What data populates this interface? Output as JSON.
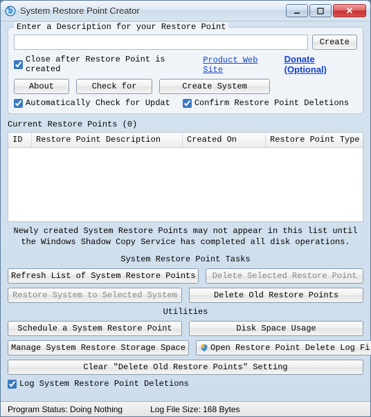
{
  "window": {
    "title": "System Restore Point Creator"
  },
  "descGroup": {
    "label": "Enter a Description for your Restore Point",
    "value": "",
    "createBtn": "Create",
    "closeAfter": "Close after Restore Point is created",
    "productSite": "Product Web Site",
    "donate": "Donate (Optional)"
  },
  "buttons": {
    "about": "About",
    "checkFor": "Check for",
    "createSystem": "Create System"
  },
  "checks": {
    "autoCheck": "Automatically Check for Updat",
    "confirmDel": "Confirm Restore Point Deletions",
    "logDeletions": "Log System Restore Point Deletions"
  },
  "list": {
    "heading": "Current Restore Points (0)",
    "columns": [
      "ID",
      "Restore Point Description",
      "Created On",
      "Restore Point Type"
    ],
    "note": "Newly created System Restore Points may not appear in this list until the Windows Shadow Copy Service has completed all disk operations."
  },
  "tasks": {
    "heading": "System Restore Point Tasks",
    "refresh": "Refresh List of System Restore Points",
    "deleteSelected": "Delete Selected Restore Point",
    "restoreSystem": "Restore System to Selected System",
    "deleteOld": "Delete Old Restore Points"
  },
  "util": {
    "heading": "Utilities",
    "schedule": "Schedule a System Restore Point",
    "diskUsage": "Disk Space Usage",
    "manageStorage": "Manage System Restore Storage Space",
    "openLog": "Open Restore Point Delete Log File",
    "clearSetting": "Clear \"Delete Old Restore Points\" Setting"
  },
  "status": {
    "program": "Program Status:  Doing Nothing",
    "logSize": "Log File Size:  168 Bytes"
  }
}
